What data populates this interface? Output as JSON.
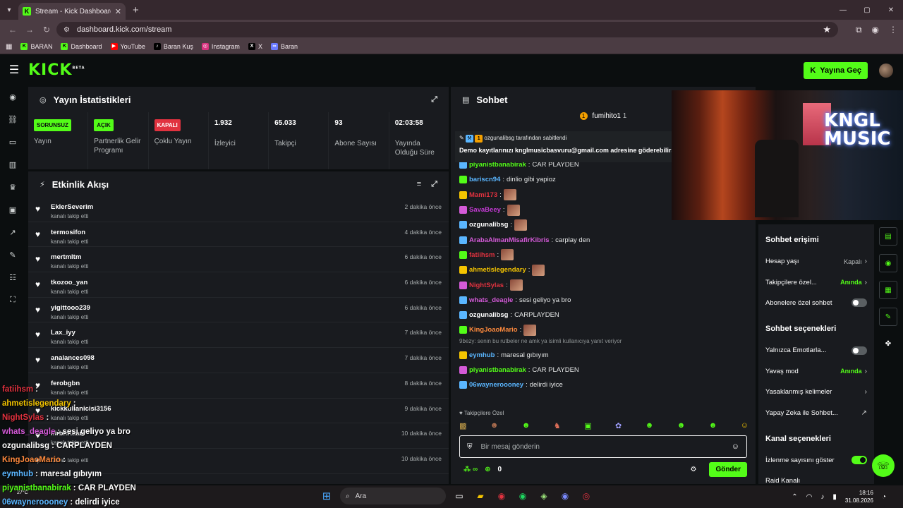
{
  "browser": {
    "tab_title": "Stream - Kick Dashboard",
    "url": "dashboard.kick.com/stream",
    "bookmarks": [
      "BARAN",
      "Dashboard",
      "YouTube",
      "Baran Kuş",
      "Instagram",
      "X",
      "Baran"
    ]
  },
  "header": {
    "logo": "KICK",
    "logo_beta": "BETA",
    "go_live": "Yayına Geç"
  },
  "stats": {
    "title": "Yayın İstatistikleri",
    "items": [
      {
        "badge": "SORUNSUZ",
        "label": "Yayın",
        "badge_color": "green"
      },
      {
        "badge": "AÇIK",
        "label": "Partnerlik Gelir Programı",
        "badge_color": "green"
      },
      {
        "badge": "KAPALI",
        "label": "Çoklu Yayın",
        "badge_color": "red"
      },
      {
        "value": "1.932",
        "label": "İzleyici"
      },
      {
        "value": "65.033",
        "label": "Takipçi"
      },
      {
        "value": "93",
        "label": "Abone Sayısı"
      },
      {
        "value": "02:03:58",
        "label": "Yayında Olduğu Süre"
      }
    ]
  },
  "activity": {
    "title": "Etkinlik Akışı",
    "items": [
      {
        "name": "EklerSeverim",
        "sub": "kanalı takip etti",
        "time": "2 dakika önce"
      },
      {
        "name": "termosifon",
        "sub": "kanalı takip etti",
        "time": "4 dakika önce"
      },
      {
        "name": "mertmltm",
        "sub": "kanalı takip etti",
        "time": "6 dakika önce"
      },
      {
        "name": "tkozoo_yan",
        "sub": "kanalı takip etti",
        "time": "6 dakika önce"
      },
      {
        "name": "yigittooo239",
        "sub": "kanalı takip etti",
        "time": "6 dakika önce"
      },
      {
        "name": "Lax_iyy",
        "sub": "kanalı takip etti",
        "time": "7 dakika önce"
      },
      {
        "name": "analances098",
        "sub": "kanalı takip etti",
        "time": "7 dakika önce"
      },
      {
        "name": "ferobgbn",
        "sub": "kanalı takip etti",
        "time": "8 dakika önce"
      },
      {
        "name": "kickkullanicisi3156",
        "sub": "kanalı takip etti",
        "time": "9 dakika önce"
      },
      {
        "name": "MrbhKaan",
        "sub": "kanalı takip etti",
        "time": "10 dakika önce"
      },
      {
        "name": "",
        "sub": "kanalı takip etti",
        "time": "10 dakika önce"
      }
    ]
  },
  "chat": {
    "title": "Sohbet",
    "top_user": "fumihito1",
    "top_count": "1",
    "pinned_by": "ozgunalibsg tarafından sabitlendi",
    "pinned_msg": "Demo kayıtlarınızı knglmusicbasvuru@gmail.com adresine göderebilirsiniz.",
    "messages": [
      {
        "user": "piyanistbanabirak",
        "text": "CAR PLAYDEN",
        "color": "#53fc18"
      },
      {
        "user": "bariscn94",
        "text": "dinlio gibi yapioz",
        "color": "#5ab6ff"
      },
      {
        "user": "Mami173",
        "text": "",
        "color": "#e1323f",
        "emote": true
      },
      {
        "user": "SavaBeey",
        "text": "",
        "color": "#c13ad1",
        "emote": true
      },
      {
        "user": "ozgunalibsg",
        "text": "",
        "color": "#ffffff",
        "emote": true
      },
      {
        "user": "ArabaAlmanMisafirKibris",
        "text": "carplay den",
        "color": "#d45ad8"
      },
      {
        "user": "fatiihsm",
        "text": "",
        "color": "#e1323f",
        "emote": true
      },
      {
        "user": "ahmetislegendary",
        "text": "",
        "color": "#f4c400",
        "emote": true
      },
      {
        "user": "NightSylas",
        "text": "",
        "color": "#e1323f",
        "emote": true
      },
      {
        "user": "whats_deagle",
        "text": "sesi geliyo ya bro",
        "color": "#d45ad8"
      },
      {
        "user": "ozgunalibsg",
        "text": "CARPLAYDEN",
        "color": "#ffffff"
      },
      {
        "user": "KingJoaoMario",
        "text": "",
        "color": "#ff8a3d",
        "emote": true
      }
    ],
    "reply_hint": "9bezy: senin bu rutbeler ne amk ya isimli kullanıcıya yanıt veriyor",
    "messages2": [
      {
        "user": "eymhub",
        "text": "maresal gıbıyım",
        "color": "#5ab6ff"
      },
      {
        "user": "piyanistbanabirak",
        "text": "CAR PLAYDEN",
        "color": "#53fc18"
      },
      {
        "user": "06wayneroooney",
        "text": "delirdi iyice",
        "color": "#5ab6ff"
      }
    ],
    "followers_only": "Takipçilere Özel",
    "input_placeholder": "Bir mesaj gönderin",
    "kick_count": "0",
    "send": "Gönder"
  },
  "settings": {
    "section1": "Sohbet erişimi",
    "rows1": [
      {
        "label": "Hesap yaşı",
        "value": "Kapalı",
        "type": "chev"
      },
      {
        "label": "Takipçilere özel...",
        "value": "Anında",
        "type": "chev",
        "green": true
      },
      {
        "label": "Abonelere özel sohbet",
        "type": "toggle",
        "on": false
      }
    ],
    "section2": "Sohbet seçenekleri",
    "rows2": [
      {
        "label": "Yalnızca Emotlarla...",
        "type": "toggle",
        "on": false
      },
      {
        "label": "Yavaş mod",
        "value": "Anında",
        "type": "chev",
        "green": true
      },
      {
        "label": "Yasaklanmış kelimeler",
        "type": "chev"
      },
      {
        "label": "Yapay Zeka ile Sohbet...",
        "type": "ext"
      }
    ],
    "section3": "Kanal seçenekleri",
    "rows3": [
      {
        "label": "İzlenme sayısını göster",
        "type": "toggle",
        "on": true
      },
      {
        "label": "Raid Kanalı",
        "type": "none"
      }
    ]
  },
  "webcam": {
    "neon_text": "KNGL MUSIC"
  },
  "overlay": [
    {
      "user": "fatiihsm",
      "text": ":",
      "color": "#e1323f"
    },
    {
      "user": "ahmetislegendary",
      "text": ":",
      "color": "#f4c400"
    },
    {
      "user": "NightSylas",
      "text": ":",
      "color": "#e1323f"
    },
    {
      "user": "whats_deagle",
      "text": ": sesi geliyo ya bro",
      "color": "#d45ad8"
    },
    {
      "user": "ozgunalibsg",
      "text": ": CARPLAYDEN",
      "color": "#ffffff"
    },
    {
      "user": "KingJoaoMario",
      "text": ":",
      "color": "#ff8a3d"
    },
    {
      "user": "eymhub",
      "text": ": maresal gıbıyım",
      "color": "#5ab6ff"
    },
    {
      "user": "piyanistbanabirak",
      "text": ": CAR PLAYDEN",
      "color": "#53fc18"
    },
    {
      "user": "06wayneroooney",
      "text": ": delirdi iyice",
      "color": "#5ab6ff"
    }
  ],
  "taskbar": {
    "search": "Ara",
    "temp": "27°C",
    "time": "18:16",
    "date": "31.08.2026"
  }
}
